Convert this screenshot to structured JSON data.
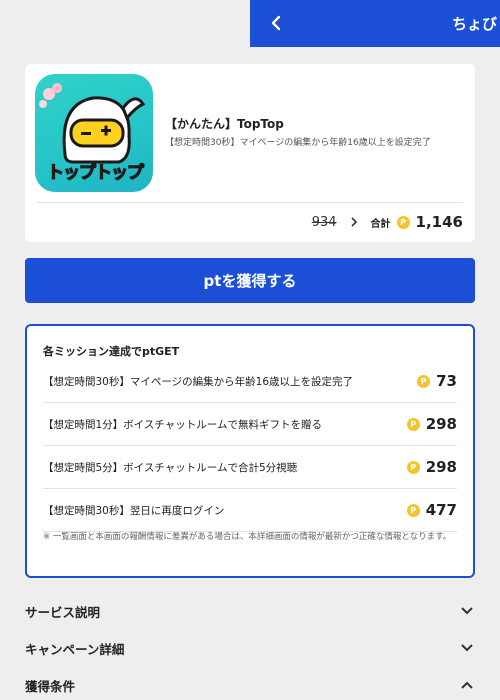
{
  "header": {
    "title": "ちょび"
  },
  "app": {
    "name": "【かんたん】TopTop",
    "description": "【想定時間30秒】マイページの編集から年齢16歳以上を設定完了",
    "icon_text": "トップトップ",
    "old_points": "934",
    "total_label": "合計",
    "total_points": "1,146"
  },
  "get_button": {
    "label": "ptを獲得する"
  },
  "missions": {
    "heading": "各ミッション達成でptGET",
    "items": [
      {
        "text": "【想定時間30秒】マイページの編集から年齢16歳以上を設定完了",
        "points": "73"
      },
      {
        "text": "【想定時間1分】ボイスチャットルームで無料ギフトを贈る",
        "points": "298"
      },
      {
        "text": "【想定時間5分】ボイスチャットルームで合計5分視聴",
        "points": "298"
      },
      {
        "text": "【想定時間30秒】翌日に再度ログイン",
        "points": "477"
      }
    ],
    "note": "※ 一覧画面と本画面の報酬情報に差異がある場合は、本詳細画面の情報が最新かつ正確な情報となります。"
  },
  "sections": [
    {
      "label": "サービス説明",
      "state": "collapsed"
    },
    {
      "label": "キャンペーン詳細",
      "state": "collapsed"
    },
    {
      "label": "獲得条件",
      "state": "expanded"
    }
  ],
  "colors": {
    "accent": "#1a4fd6",
    "coin": "#f4c430",
    "icon_bg": "#2fd2c8"
  },
  "icons": {
    "back": "chevron-left-icon",
    "coin": "point-coin-icon",
    "expand": "chevron-down-icon",
    "collapse": "chevron-up-icon"
  }
}
